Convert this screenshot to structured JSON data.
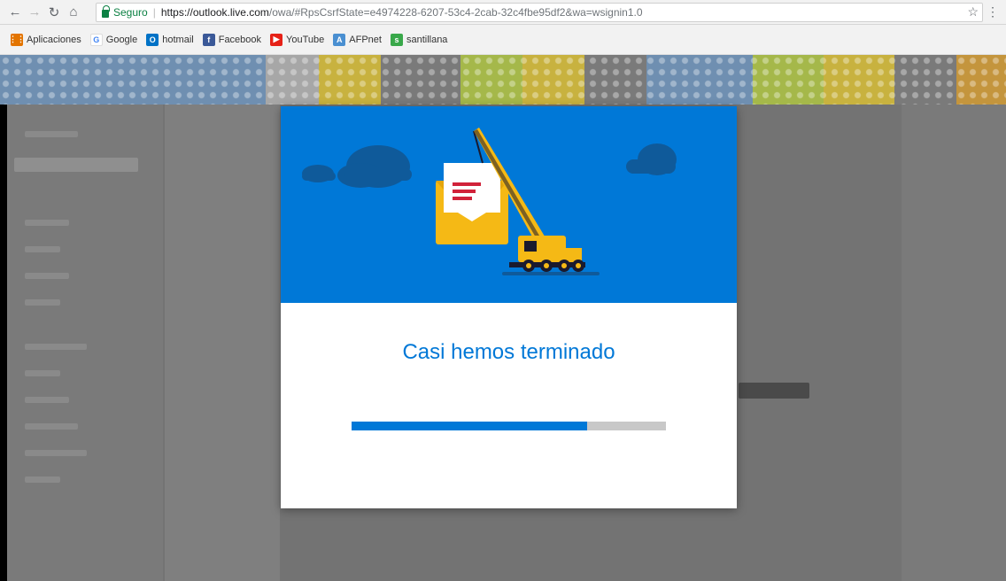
{
  "browser": {
    "secure_label": "Seguro",
    "url_host": "https://outlook.live.com",
    "url_rest": "/owa/#RpsCsrfState=e4974228-6207-53c4-2cab-32c4fbe95df2&wa=wsignin1.0",
    "bookmarks": [
      {
        "label": "Aplicaciones",
        "icon": "apps-grid-icon",
        "color": "#e37400"
      },
      {
        "label": "Google",
        "icon": "google-icon",
        "color": "#4285f4"
      },
      {
        "label": "hotmail",
        "icon": "outlook-icon",
        "color": "#0072c6"
      },
      {
        "label": "Facebook",
        "icon": "facebook-icon",
        "color": "#3b5998"
      },
      {
        "label": "YouTube",
        "icon": "youtube-icon",
        "color": "#e62117"
      },
      {
        "label": "AFPnet",
        "icon": "afpnet-icon",
        "color": "#4a8fd1"
      },
      {
        "label": "santillana",
        "icon": "santillana-icon",
        "color": "#39a84a"
      }
    ]
  },
  "dialog": {
    "title": "Casi hemos terminado",
    "progress": 0.75,
    "accent": "#0078d7"
  }
}
